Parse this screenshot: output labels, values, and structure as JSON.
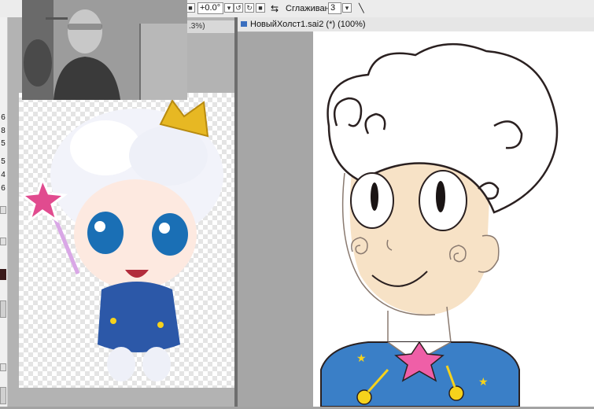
{
  "toolbar": {
    "rotation_value": "+0.0°",
    "smoothing_label": "Сглаживание",
    "smoothing_value": "3",
    "rotate_left_icon": "rotate-left-icon",
    "rotate_right_icon": "rotate-right-icon",
    "reset_icon": "reset-icon",
    "swap_icon": "swap-icon",
    "line_icon": "line-icon"
  },
  "reference_window": {
    "title_fragment": ".3%)"
  },
  "canvas_window": {
    "title": "НовыйХолст1.sai2 (*) (100%)"
  },
  "left_strip": {
    "numbers": [
      "6",
      "8",
      "5",
      "5",
      "4",
      "6"
    ]
  },
  "colors": {
    "canvas_gray": "#a6a6a6",
    "skin": "#f7e2c6",
    "shirt_blue": "#3a7fc7",
    "star_yellow": "#f6d21c",
    "bow_pink": "#ef5fa7"
  }
}
